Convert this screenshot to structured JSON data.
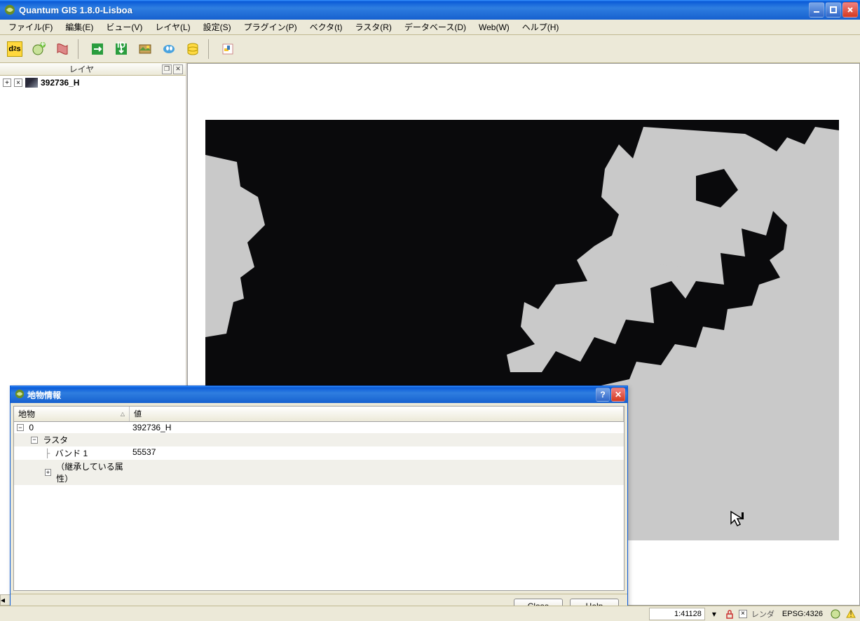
{
  "window": {
    "title": "Quantum GIS 1.8.0-Lisboa"
  },
  "menu": {
    "items": [
      "ファイル(F)",
      "編集(E)",
      "ビュー(V)",
      "レイヤ(L)",
      "設定(S)",
      "プラグイン(P)",
      "ベクタ(t)",
      "ラスタ(R)",
      "データベース(D)",
      "Web(W)",
      "ヘルプ(H)"
    ]
  },
  "toolbar": {
    "buttons": [
      {
        "name": "d2s",
        "ico": "d2s"
      },
      {
        "name": "add-vector-layer",
        "ico": "plus-globe"
      },
      {
        "name": "add-raster-layer",
        "ico": "raster"
      },
      {
        "sep": true
      },
      {
        "name": "zoom-full",
        "ico": "zoom-full"
      },
      {
        "name": "zoom-selection",
        "ico": "zoom-sel"
      },
      {
        "name": "export-image",
        "ico": "image"
      },
      {
        "name": "map-tips",
        "ico": "tips"
      },
      {
        "name": "database",
        "ico": "db"
      },
      {
        "sep": true
      },
      {
        "name": "python-console",
        "ico": "python"
      }
    ]
  },
  "layers_panel": {
    "title": "レイヤ",
    "layer_name": "392736_H"
  },
  "identify": {
    "title": "地物情報",
    "columns": {
      "feature": "地物",
      "value": "値"
    },
    "rows": [
      {
        "indent": 0,
        "toggle": "−",
        "label": "0",
        "value": "392736_H"
      },
      {
        "indent": 1,
        "toggle": "−",
        "label": "ラスタ",
        "value": ""
      },
      {
        "indent": 2,
        "toggle": "",
        "label": "バンド 1",
        "value": "55537",
        "branch": "├"
      },
      {
        "indent": 2,
        "toggle": "+",
        "label": "（継承している属性）",
        "value": ""
      }
    ],
    "buttons": {
      "close": "Close",
      "help": "Help"
    }
  },
  "status": {
    "scale": "1:41128",
    "render_label": "レンダ",
    "crs": "EPSG:4326"
  }
}
